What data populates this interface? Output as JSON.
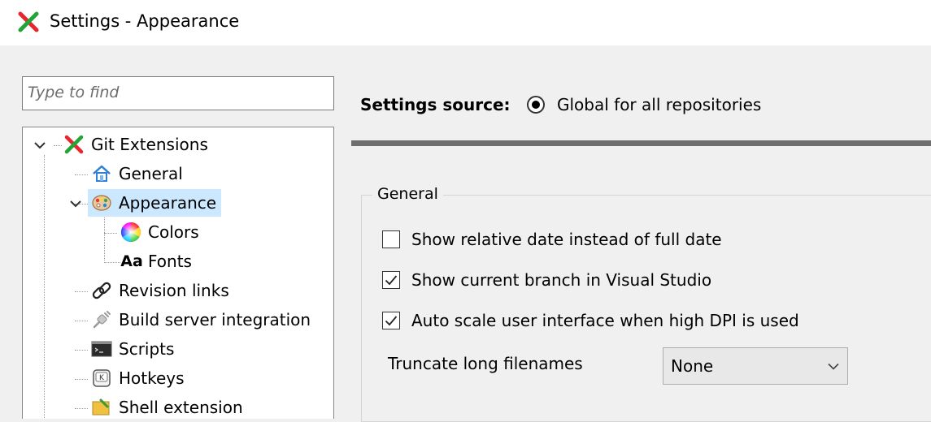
{
  "window": {
    "title": "Settings - Appearance",
    "icon": "git-extensions-icon"
  },
  "search": {
    "placeholder": "Type to find",
    "value": ""
  },
  "tree": {
    "root": {
      "label": "Git Extensions",
      "icon": "git-extensions-icon",
      "expanded": true
    },
    "items": [
      {
        "label": "General",
        "icon": "home-icon"
      },
      {
        "label": "Appearance",
        "icon": "palette-icon",
        "selected": true,
        "expanded": true
      },
      {
        "label": "Colors",
        "icon": "color-wheel-icon"
      },
      {
        "label": "Fonts",
        "icon": "font-icon",
        "icon_text": "Aa"
      },
      {
        "label": "Revision links",
        "icon": "link-icon"
      },
      {
        "label": "Build server integration",
        "icon": "plug-icon"
      },
      {
        "label": "Scripts",
        "icon": "terminal-icon"
      },
      {
        "label": "Hotkeys",
        "icon": "keyboard-icon"
      },
      {
        "label": "Shell extension",
        "icon": "shell-extension-icon"
      }
    ]
  },
  "settings_source": {
    "label": "Settings source:",
    "option": "Global for all repositories",
    "selected": true
  },
  "general_group": {
    "title": "General",
    "checkboxes": [
      {
        "label": "Show relative date instead of full date",
        "checked": false
      },
      {
        "label": "Show current branch in Visual Studio",
        "checked": true
      },
      {
        "label": "Auto scale user interface when high DPI is used",
        "checked": true
      }
    ],
    "truncate": {
      "label": "Truncate long filenames",
      "value": "None"
    }
  },
  "colors": {
    "selection": "#cce8ff",
    "separator": "#6e6e6e",
    "window_bg": "#f0f0f0"
  }
}
